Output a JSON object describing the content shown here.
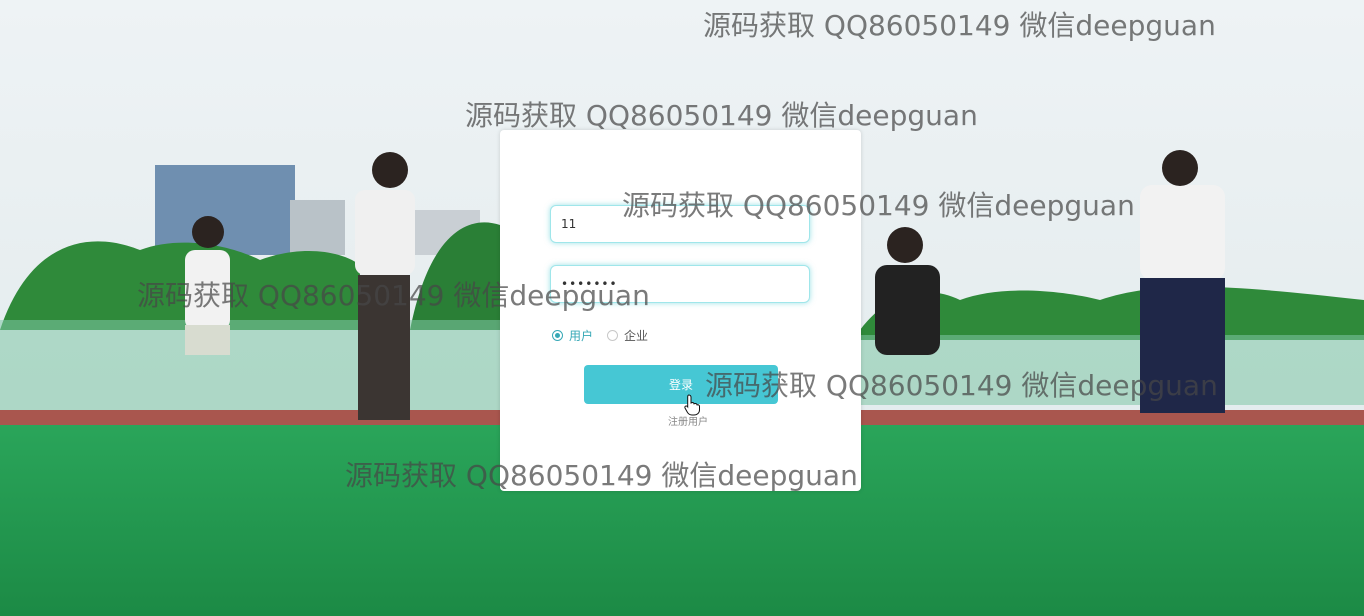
{
  "login": {
    "username_value": "11",
    "password_value": "•••••••",
    "role_options": [
      "用户",
      "企业"
    ],
    "selected_role": "用户",
    "submit_label": "登录",
    "register_label": "注册用户"
  },
  "watermarks": [
    "源码获取 QQ86050149 微信deepguan",
    "源码获取 QQ86050149 微信deepguan",
    "源码获取 QQ86050149 微信deepguan",
    "源码获取 QQ86050149 微信deepguan",
    "源码获取 QQ86050149 微信deepguan",
    "源码获取 QQ86050149 微信deepguan"
  ],
  "colors": {
    "accent": "#46c7d4",
    "field_glow": "#9fe6ea",
    "radio_checked": "#36a8b6",
    "grass": "#1f9a4f"
  }
}
